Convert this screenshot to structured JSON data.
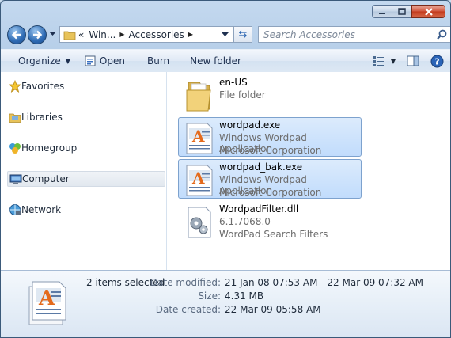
{
  "window": {
    "buttons": {
      "minimize": "minimize-icon",
      "maximize": "maximize-icon",
      "close": "close-icon"
    }
  },
  "address": {
    "prefix": "«",
    "segments": [
      "Win...",
      "Accessories"
    ],
    "search_placeholder": "Search Accessories"
  },
  "toolbar": {
    "organize": "Organize",
    "open": "Open",
    "burn": "Burn",
    "new_folder": "New folder"
  },
  "nav": {
    "items": [
      {
        "label": "Favorites",
        "icon": "star-icon"
      },
      {
        "label": "Libraries",
        "icon": "libraries-icon"
      },
      {
        "label": "Homegroup",
        "icon": "homegroup-icon"
      },
      {
        "label": "Computer",
        "icon": "computer-icon"
      },
      {
        "label": "Network",
        "icon": "network-icon"
      }
    ],
    "selected": "Computer"
  },
  "files": [
    {
      "name": "en-US",
      "line2": "File folder",
      "line3": "",
      "icon": "folder-icon",
      "selected": false
    },
    {
      "name": "wordpad.exe",
      "line2": "Windows Wordpad Application",
      "line3": "Microsoft Corporation",
      "icon": "wordpad-icon",
      "selected": true
    },
    {
      "name": "wordpad_bak.exe",
      "line2": "Windows Wordpad Application",
      "line3": "Microsoft Corporation",
      "icon": "wordpad-icon",
      "selected": true
    },
    {
      "name": "WordpadFilter.dll",
      "line2": "6.1.7068.0",
      "line3": "WordPad Search Filters",
      "icon": "dll-icon",
      "selected": false
    }
  ],
  "details": {
    "selection": "2 items selected",
    "date_modified_label": "Date modified:",
    "date_modified": "21 Jan 08 07:53 AM - 22 Mar 09 07:32 AM",
    "size_label": "Size:",
    "size": "4.31 MB",
    "date_created_label": "Date created:",
    "date_created": "22 Mar 09 05:58 AM"
  },
  "colors": {
    "selection_fill": "#c1dcfc",
    "selection_border": "#7da2ce",
    "chrome": "#b7cfe9"
  }
}
